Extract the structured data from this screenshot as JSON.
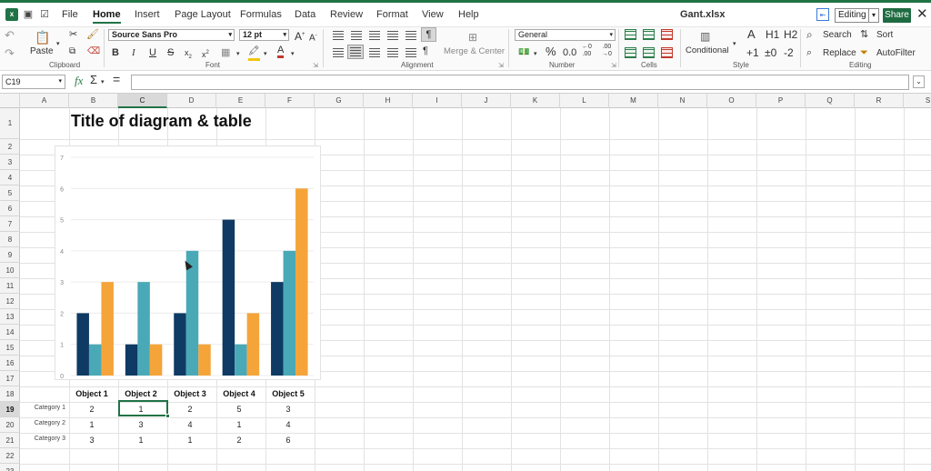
{
  "app": {
    "filename": "Gant.xlsx",
    "mode": "Editing",
    "share": "Share"
  },
  "menu": [
    "File",
    "Home",
    "Insert",
    "Page Layout",
    "Formulas",
    "Data",
    "Review",
    "Format",
    "View",
    "Help"
  ],
  "menu_active": "Home",
  "ribbon": {
    "clipboard": {
      "paste": "Paste",
      "group": "Clipboard"
    },
    "font": {
      "family": "Source Sans Pro",
      "size": "12 pt",
      "group": "Font"
    },
    "alignment": {
      "merge": "Merge & Center",
      "group": "Alignment"
    },
    "number": {
      "format": "General",
      "group": "Number"
    },
    "cells": {
      "group": "Cells"
    },
    "style": {
      "conditional": "Conditional",
      "group": "Style",
      "h1": "H1",
      "h2": "H2",
      "plus1": "+1",
      "zero": "±0",
      "minus2": "-2"
    },
    "editing": {
      "search": "Search",
      "sort": "Sort",
      "replace": "Replace",
      "autofilter": "AutoFilter",
      "group": "Editing"
    }
  },
  "formula_bar": {
    "name_box": "C19",
    "fx": "fx",
    "sigma": "Σ",
    "equals": "=",
    "value": ""
  },
  "sheet": {
    "columns": [
      "A",
      "B",
      "C",
      "D",
      "E",
      "F",
      "G",
      "H",
      "I",
      "J",
      "K",
      "L",
      "M",
      "N",
      "O",
      "P",
      "Q",
      "R",
      "S"
    ],
    "rows": [
      "1",
      "2",
      "3",
      "4",
      "5",
      "6",
      "7",
      "8",
      "9",
      "10",
      "11",
      "12",
      "13",
      "14",
      "15",
      "16",
      "17",
      "18",
      "19",
      "20",
      "21",
      "22",
      "23"
    ],
    "selected_column": "C",
    "selected_row": "19",
    "title": "Title of diagram & table",
    "table": {
      "headers": [
        "Object 1",
        "Object 2",
        "Object 3",
        "Object 4",
        "Object 5"
      ],
      "rows": [
        {
          "label": "Category 1",
          "values": [
            "2",
            "1",
            "2",
            "5",
            "3"
          ]
        },
        {
          "label": "Category 2",
          "values": [
            "1",
            "3",
            "4",
            "1",
            "4"
          ]
        },
        {
          "label": "Category 3",
          "values": [
            "3",
            "1",
            "1",
            "2",
            "6"
          ]
        }
      ]
    }
  },
  "chart_data": {
    "type": "bar",
    "categories": [
      "Object 1",
      "Object 2",
      "Object 3",
      "Object 4",
      "Object 5"
    ],
    "series": [
      {
        "values": [
          2,
          1,
          2,
          5,
          3
        ],
        "color": "#0e3a63"
      },
      {
        "values": [
          1,
          3,
          4,
          1,
          4
        ],
        "color": "#4aa9b7"
      },
      {
        "values": [
          3,
          1,
          1,
          2,
          6
        ],
        "color": "#f5a43a"
      }
    ],
    "yticks": [
      "0",
      "1",
      "2",
      "3",
      "4",
      "5",
      "6",
      "7"
    ],
    "ylim": [
      0,
      7
    ],
    "grid": true
  }
}
